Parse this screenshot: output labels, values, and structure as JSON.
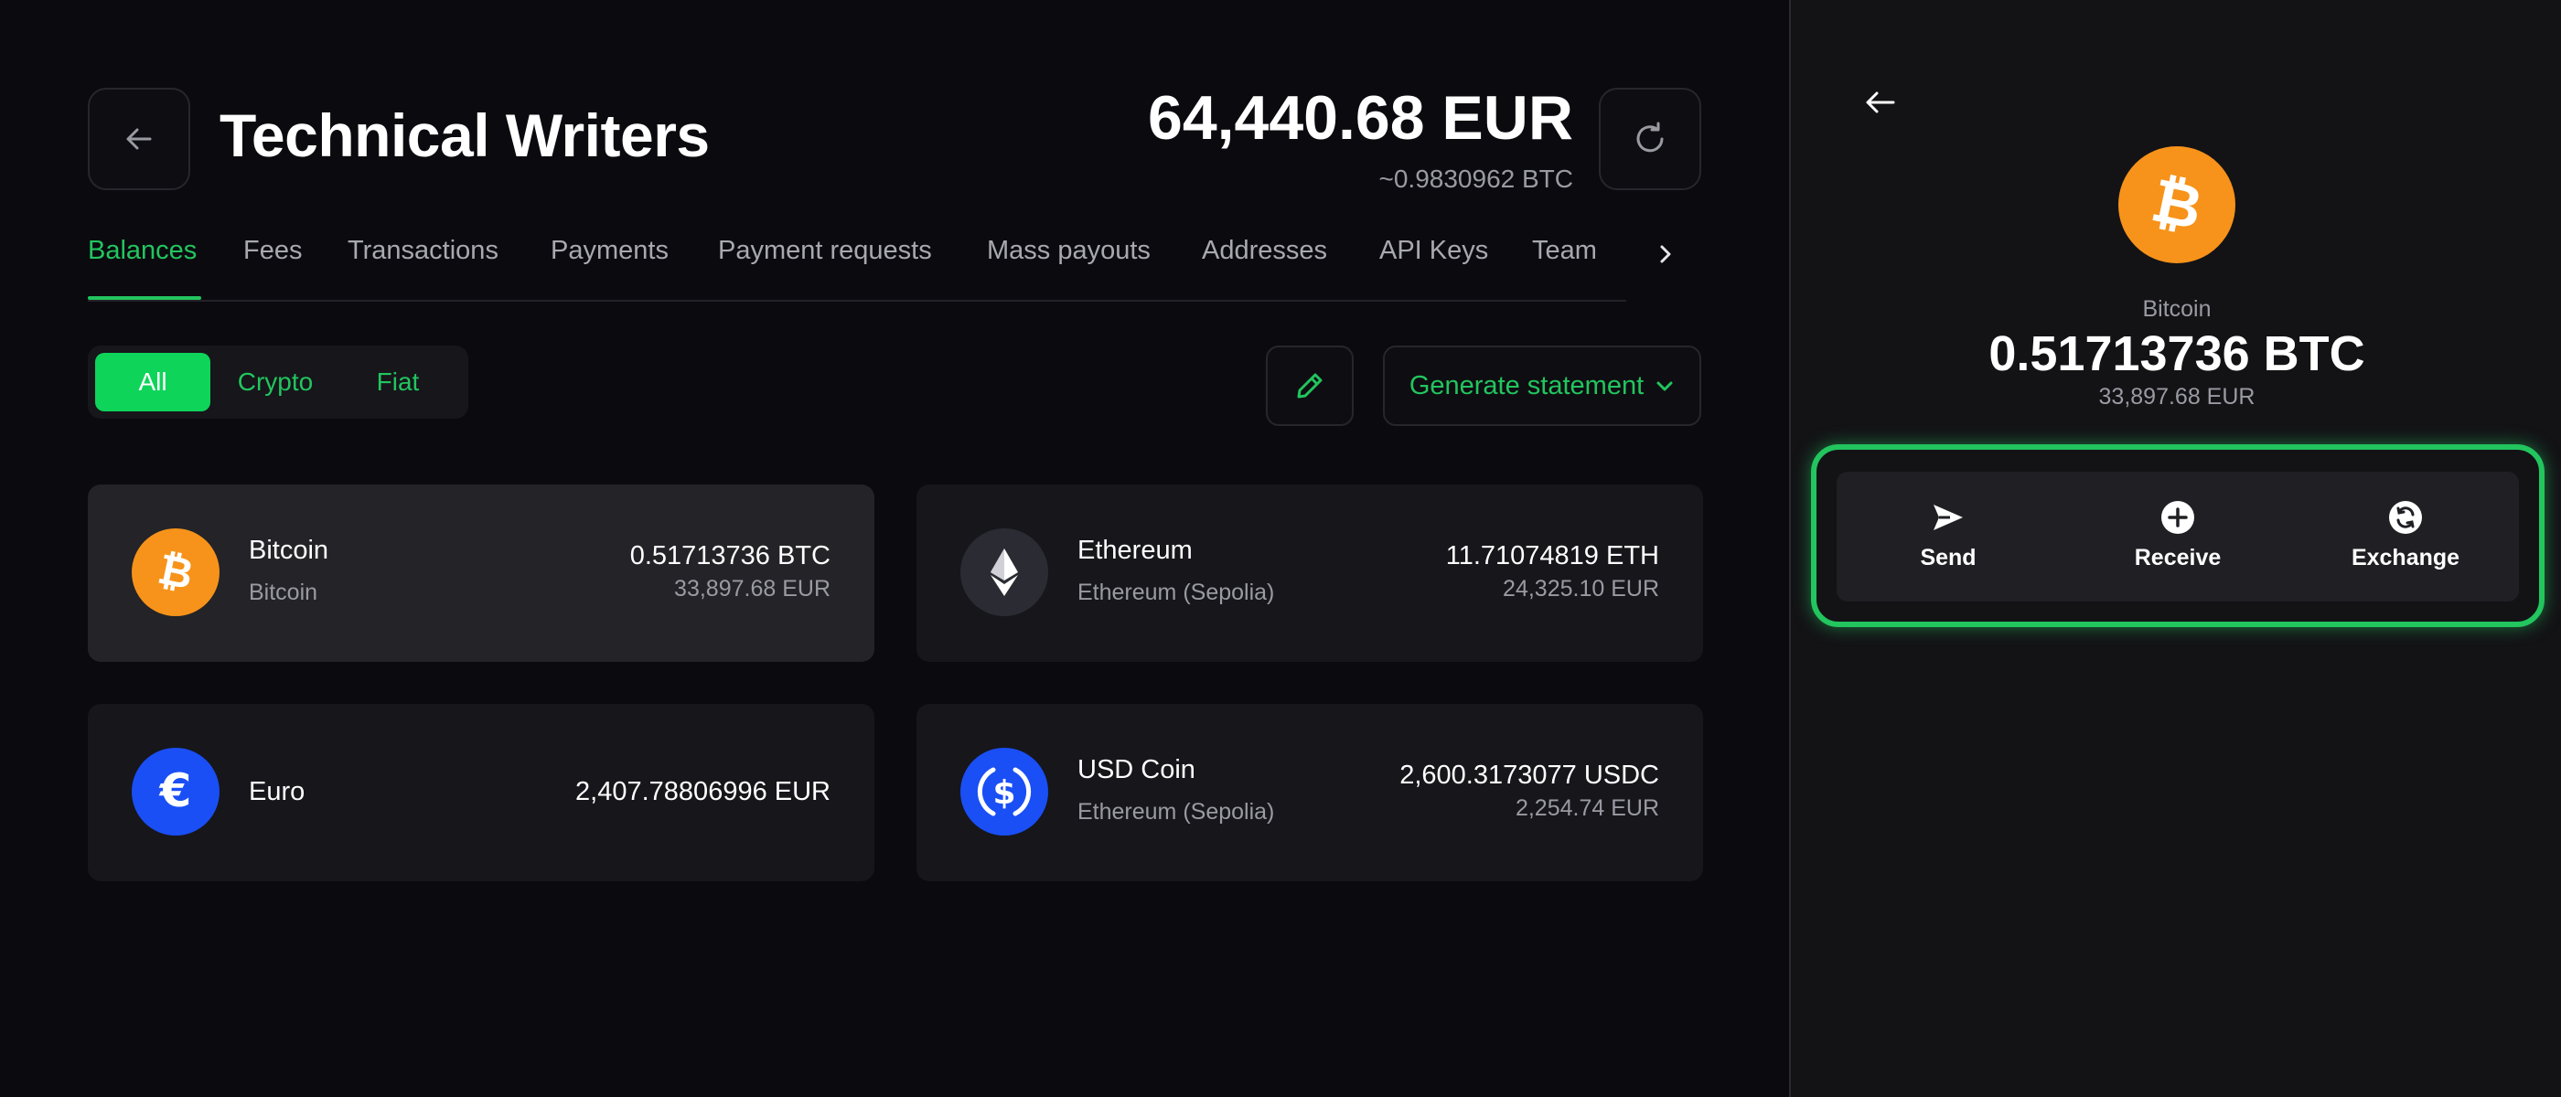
{
  "header": {
    "title": "Technical Writers",
    "total_amount": "64,440.68 EUR",
    "total_btc": "~0.9830962 BTC"
  },
  "tabs": [
    {
      "label": "Balances",
      "active": true
    },
    {
      "label": "Fees"
    },
    {
      "label": "Transactions"
    },
    {
      "label": "Payments"
    },
    {
      "label": "Payment requests"
    },
    {
      "label": "Mass payouts"
    },
    {
      "label": "Addresses"
    },
    {
      "label": "API Keys"
    },
    {
      "label": "Team"
    }
  ],
  "filter": {
    "options": [
      "All",
      "Crypto",
      "Fiat"
    ],
    "selected": "All"
  },
  "toolbar": {
    "statement_label": "Generate statement"
  },
  "balances": [
    {
      "name": "Bitcoin",
      "network": "Bitcoin",
      "amount": "0.51713736 BTC",
      "fiat": "33,897.68 EUR",
      "icon": "bitcoin-icon",
      "color": "#f7931a"
    },
    {
      "name": "Ethereum",
      "network": "Ethereum (Sepolia)",
      "amount": "11.71074819 ETH",
      "fiat": "24,325.10 EUR",
      "icon": "ethereum-icon",
      "color": "#2b2b33"
    },
    {
      "name": "Euro",
      "network": "",
      "amount": "2,407.78806996 EUR",
      "fiat": "",
      "icon": "euro-icon",
      "color": "#1a4ff5"
    },
    {
      "name": "USD Coin",
      "network": "Ethereum (Sepolia)",
      "amount": "2,600.3173077 USDC",
      "fiat": "2,254.74 EUR",
      "icon": "usdc-icon",
      "color": "#1a4ff5"
    }
  ],
  "detail": {
    "name": "Bitcoin",
    "amount": "0.51713736 BTC",
    "fiat": "33,897.68 EUR",
    "actions": [
      {
        "label": "Send",
        "icon": "send-icon"
      },
      {
        "label": "Receive",
        "icon": "plus-circle-icon"
      },
      {
        "label": "Exchange",
        "icon": "exchange-icon"
      }
    ]
  },
  "colors": {
    "accent": "#22c55e",
    "bitcoin": "#f7931a",
    "blue": "#1a4ff5"
  }
}
